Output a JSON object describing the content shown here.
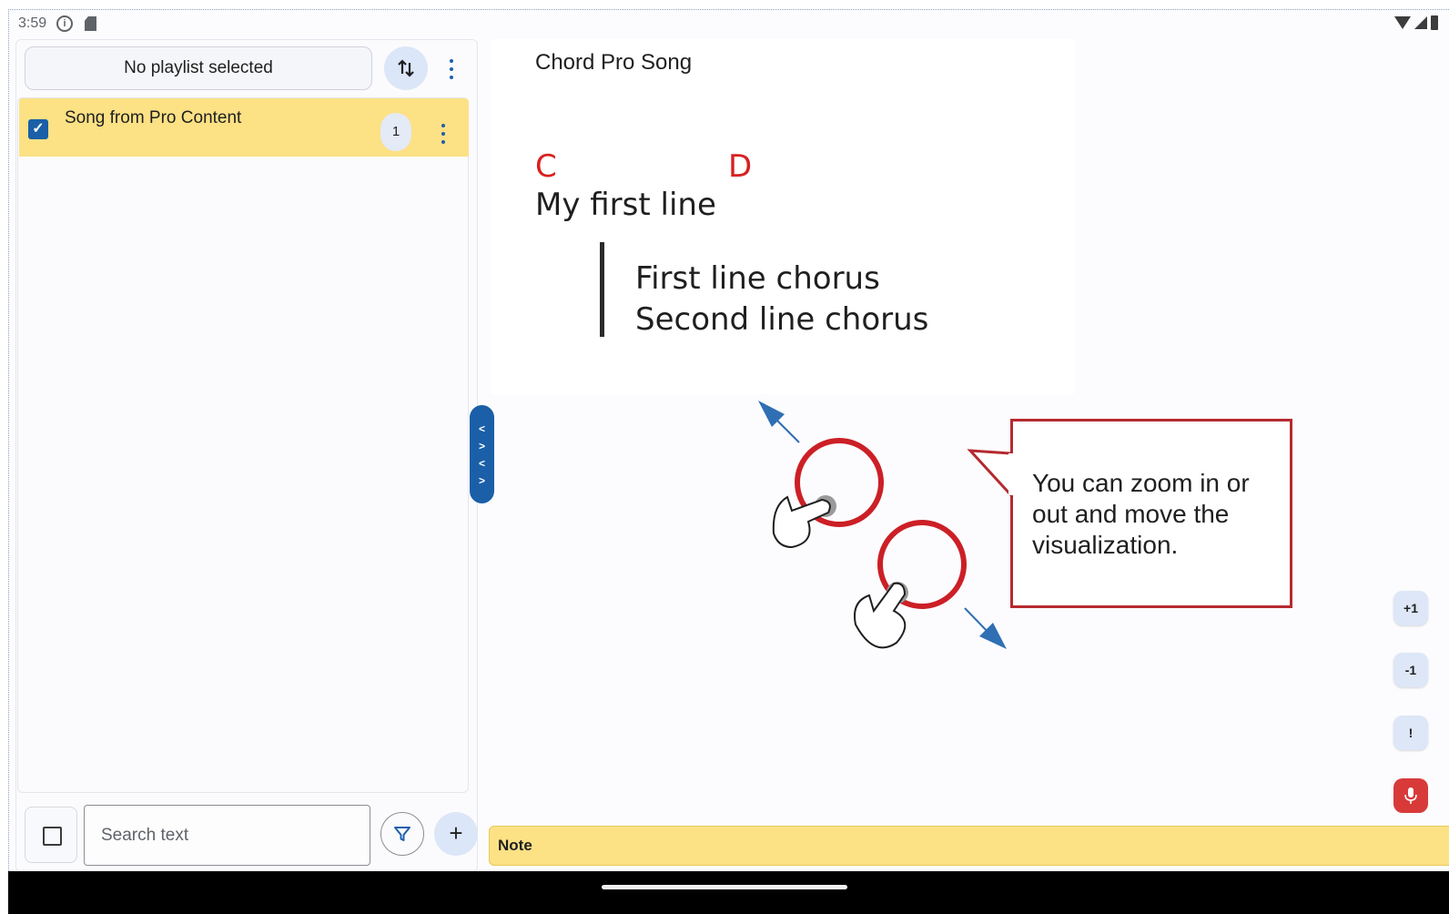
{
  "status_bar": {
    "time": "3:59",
    "icons": [
      "info-icon",
      "sd-card-icon",
      "wifi-icon",
      "signal-icon",
      "battery-icon"
    ]
  },
  "sidebar": {
    "playlist_label": "No playlist selected",
    "songs": [
      {
        "title": "Song from Pro Content",
        "checked": true,
        "count": "1"
      }
    ],
    "search_placeholder": "Search text",
    "add_label": "+"
  },
  "collapse_handle": [
    "<",
    ">",
    "<",
    ">"
  ],
  "song_view": {
    "title": "Chord Pro Song",
    "chords": [
      "C",
      "D"
    ],
    "line1": "My first line",
    "chorus": [
      "First line chorus",
      "Second line chorus"
    ]
  },
  "tutorial": {
    "text": "You can zoom in or out and move the visualization."
  },
  "side_actions": {
    "plus_one": "+1",
    "minus_one": "-1",
    "alert": "!"
  },
  "note": {
    "label": "Note"
  },
  "colors": {
    "accent": "#1a5fa8",
    "highlight": "#fce185",
    "chord": "#d91f1f",
    "callout_border": "#b52a2f",
    "mic": "#d83a3a"
  }
}
